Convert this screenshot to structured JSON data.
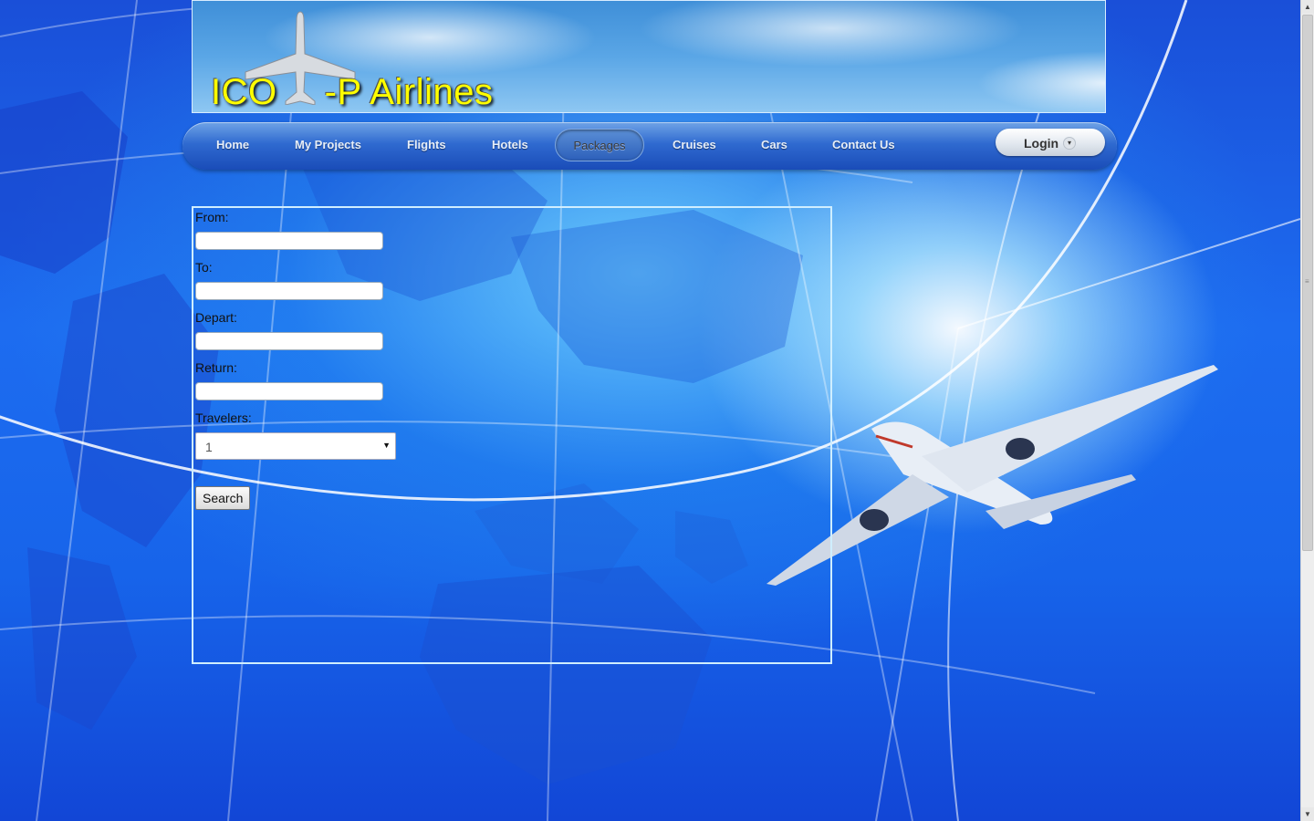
{
  "header": {
    "logo_prefix": "ICO",
    "logo_suffix": "-P Airlines"
  },
  "nav": {
    "items": [
      {
        "label": "Home"
      },
      {
        "label": "My Projects"
      },
      {
        "label": "Flights"
      },
      {
        "label": "Hotels"
      },
      {
        "label": "Packages",
        "active": true
      },
      {
        "label": "Cruises"
      },
      {
        "label": "Cars"
      },
      {
        "label": "Contact Us"
      }
    ],
    "login_label": "Login",
    "login_arrow": "▾"
  },
  "form": {
    "from_label": "From:",
    "from_value": "",
    "to_label": "To:",
    "to_value": "",
    "depart_label": "Depart:",
    "depart_value": "",
    "return_label": "Return:",
    "return_value": "",
    "travelers_label": "Travelers:",
    "travelers_value": "1",
    "search_label": "Search"
  },
  "colors": {
    "logo_text": "#ffff00",
    "background": "#1d6cf0",
    "nav": "#2f6ad0"
  },
  "icons": {
    "logo": "airplane-icon",
    "dropdown": "chevron-down-icon"
  }
}
